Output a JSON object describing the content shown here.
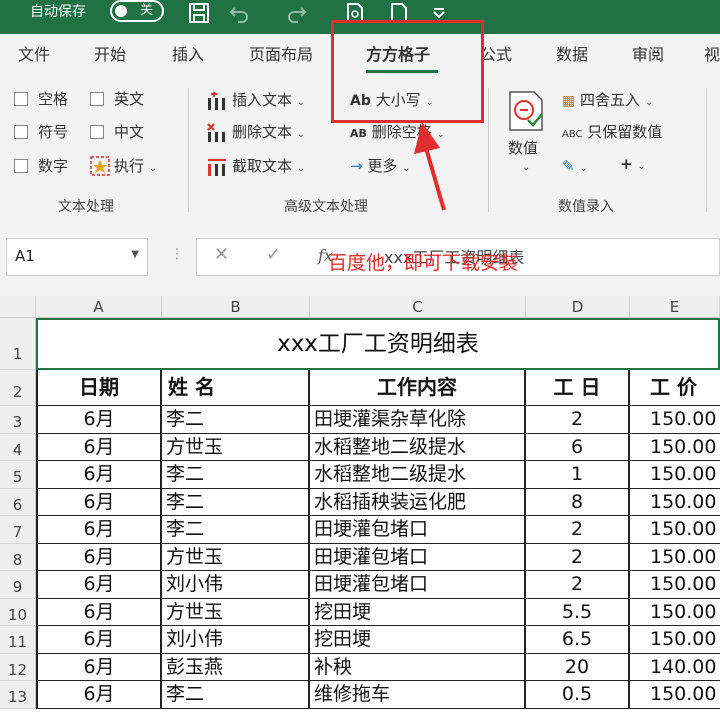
{
  "titlebar": {
    "autosave_label": "自动保存",
    "toggle_state": "关"
  },
  "tabs": [
    {
      "label": "文件"
    },
    {
      "label": "开始"
    },
    {
      "label": "插入"
    },
    {
      "label": "页面布局"
    },
    {
      "label": "方方格子",
      "active": true
    },
    {
      "label": "公式"
    },
    {
      "label": "数据"
    },
    {
      "label": "审阅"
    },
    {
      "label": "视"
    }
  ],
  "ribbon": {
    "text_processing": {
      "checkboxes": [
        "空格",
        "英文",
        "符号",
        "中文",
        "数字"
      ],
      "execute_label": "执行",
      "group_label": "文本处理"
    },
    "advanced_text": {
      "insert_text": "插入文本",
      "delete_text": "删除文本",
      "extract_text": "截取文本",
      "case": "大小写",
      "delete_space": "删除空格",
      "more": "更多",
      "group_label": "高级文本处理"
    },
    "value_entry": {
      "value": "数值",
      "round": "四舍五入",
      "keep_values": "只保留数值",
      "group_label": "数值录入"
    }
  },
  "formula_bar": {
    "name_box": "A1",
    "fx": "fx",
    "value": "xxx工厂工资明细表"
  },
  "annotation": {
    "text": "百度他，即可下载安装"
  },
  "sheet": {
    "columns": [
      "A",
      "B",
      "C",
      "D",
      "E"
    ],
    "title": "xxx工厂工资明细表",
    "headers": [
      "日期",
      "姓  名",
      "工作内容",
      "工 日",
      "工 价"
    ],
    "rows": [
      {
        "n": "3",
        "date": "6月",
        "name": "李二",
        "work": "田埂灌渠杂草化除",
        "days": "2",
        "price": "150.00"
      },
      {
        "n": "4",
        "date": "6月",
        "name": "方世玉",
        "work": "水稻整地二级提水",
        "days": "6",
        "price": "150.00"
      },
      {
        "n": "5",
        "date": "6月",
        "name": "李二",
        "work": "水稻整地二级提水",
        "days": "1",
        "price": "150.00"
      },
      {
        "n": "6",
        "date": "6月",
        "name": "李二",
        "work": "水稻插秧装运化肥",
        "days": "8",
        "price": "150.00"
      },
      {
        "n": "7",
        "date": "6月",
        "name": "李二",
        "work": "田埂灌包堵口",
        "days": "2",
        "price": "150.00"
      },
      {
        "n": "8",
        "date": "6月",
        "name": "方世玉",
        "work": "田埂灌包堵口",
        "days": "2",
        "price": "150.00"
      },
      {
        "n": "9",
        "date": "6月",
        "name": "刘小伟",
        "work": "田埂灌包堵口",
        "days": "2",
        "price": "150.00"
      },
      {
        "n": "10",
        "date": "6月",
        "name": "方世玉",
        "work": "挖田埂",
        "days": "5.5",
        "price": "150.00"
      },
      {
        "n": "11",
        "date": "6月",
        "name": "刘小伟",
        "work": "挖田埂",
        "days": "6.5",
        "price": "150.00"
      },
      {
        "n": "12",
        "date": "6月",
        "name": "彭玉燕",
        "work": "补秧",
        "days": "20",
        "price": "140.00"
      },
      {
        "n": "13",
        "date": "6月",
        "name": "李二",
        "work": "维修拖车",
        "days": "0.5",
        "price": "150.00"
      }
    ]
  }
}
